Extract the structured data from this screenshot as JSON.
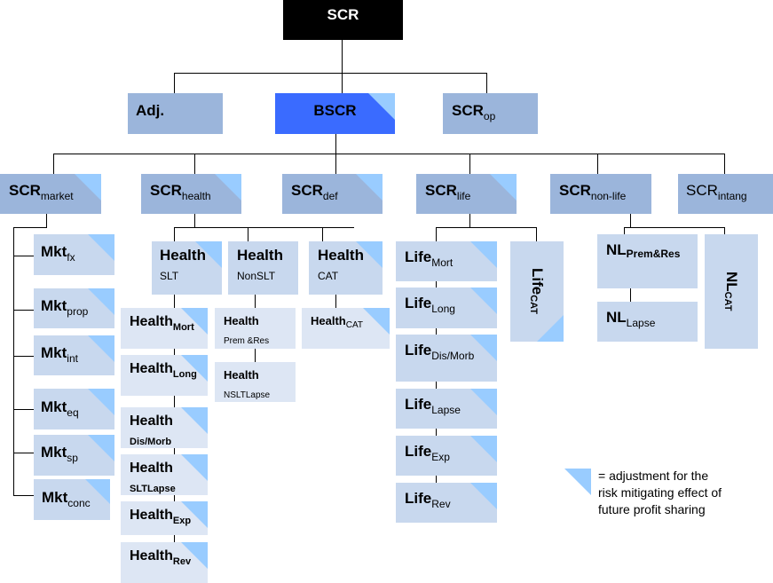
{
  "colors": {
    "root": "#000000",
    "level1": "#9bb5db",
    "bscr_highlight": "#3a6bff",
    "module": "#c8d8ee",
    "submodule": "#dde6f4",
    "adjustment_corner": "#99ccff",
    "connector": "#000000"
  },
  "root": {
    "label": "SCR"
  },
  "level1": {
    "adj": {
      "label": "Adj.",
      "sub": ""
    },
    "bscr": {
      "label": "BSCR",
      "sub": ""
    },
    "op": {
      "label": "SCR",
      "sub": "op"
    }
  },
  "modules": {
    "market": {
      "label": "SCR",
      "sub": "market"
    },
    "health": {
      "label": "SCR",
      "sub": "health"
    },
    "def": {
      "label": "SCR",
      "sub": "def"
    },
    "life": {
      "label": "SCR",
      "sub": "life"
    },
    "nonlife": {
      "label": "SCR",
      "sub": "non-life"
    },
    "intang": {
      "label": "SCR",
      "sub": "intang"
    }
  },
  "market_submodules": [
    {
      "label": "Mkt",
      "sub": "fx"
    },
    {
      "label": "Mkt",
      "sub": "prop"
    },
    {
      "label": "Mkt",
      "sub": "int"
    },
    {
      "label": "Mkt",
      "sub": "eq"
    },
    {
      "label": "Mkt",
      "sub": "sp"
    },
    {
      "label": "Mkt",
      "sub": "conc"
    }
  ],
  "health_groups": {
    "slt": {
      "label": "Health",
      "line2": "SLT"
    },
    "nonslt": {
      "label": "Health",
      "line2": "NonSLT"
    },
    "cat": {
      "label": "Health",
      "line2": "CAT"
    }
  },
  "health_slt_submodules": [
    {
      "label": "Health",
      "sub": "Mort"
    },
    {
      "label": "Health",
      "sub": "Long"
    },
    {
      "label": "Health",
      "line2": "Dis/Morb"
    },
    {
      "label": "Health",
      "line2": "SLTLapse"
    },
    {
      "label": "Health",
      "sub": "Exp"
    },
    {
      "label": "Health",
      "sub": "Rev"
    }
  ],
  "health_nonslt_submodules": [
    {
      "label": "Health",
      "line2": "Prem &Res"
    },
    {
      "label": "Health",
      "line2": "NSLTLapse"
    }
  ],
  "health_cat_submodules": [
    {
      "label": "Health",
      "sub": "CAT"
    }
  ],
  "life_submodules": [
    {
      "label": "Life",
      "sub": "Mort"
    },
    {
      "label": "Life",
      "sub": "Long"
    },
    {
      "label": "Life",
      "sub": "Dis/Morb"
    },
    {
      "label": "Life",
      "sub": "Lapse"
    },
    {
      "label": "Life",
      "sub": "Exp"
    },
    {
      "label": "Life",
      "sub": "Rev"
    }
  ],
  "life_cat": {
    "label": "Life",
    "sub": "CAT"
  },
  "nonlife_submodules": [
    {
      "label": "NL",
      "sub": "Prem&Res"
    },
    {
      "label": "NL",
      "sub": "Lapse"
    }
  ],
  "nonlife_cat": {
    "label": "NL",
    "sub": "CAT"
  },
  "legend": {
    "line1": "= adjustment for the",
    "line2": "risk mitigating effect of",
    "line3": "future profit sharing"
  }
}
